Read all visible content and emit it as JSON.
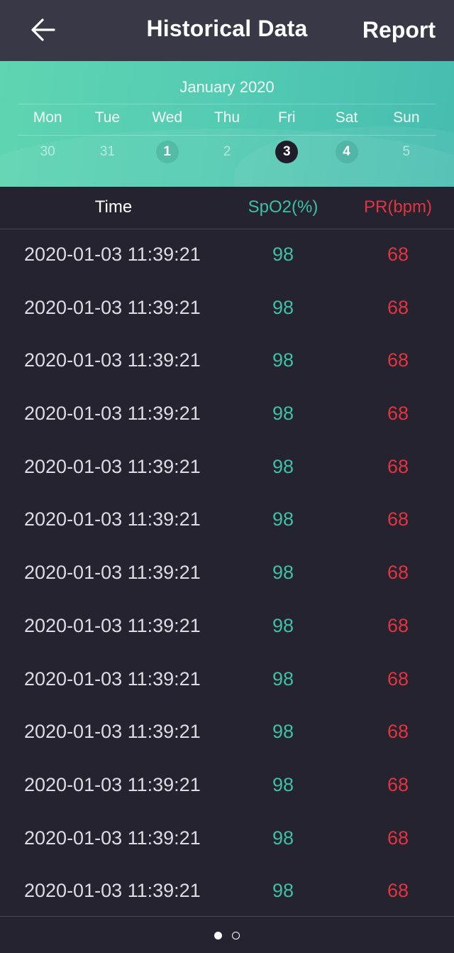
{
  "header": {
    "back_icon": "arrow-left-icon",
    "title": "Historical Data",
    "report_label": "Report"
  },
  "calendar": {
    "month_label": "January 2020",
    "weekdays": [
      "Mon",
      "Tue",
      "Wed",
      "Thu",
      "Fri",
      "Sat",
      "Sun"
    ],
    "days": [
      {
        "label": "30",
        "state": "other-month"
      },
      {
        "label": "31",
        "state": "other-month"
      },
      {
        "label": "1",
        "state": "has-data"
      },
      {
        "label": "2",
        "state": "no-data"
      },
      {
        "label": "3",
        "state": "selected"
      },
      {
        "label": "4",
        "state": "has-data"
      },
      {
        "label": "5",
        "state": "no-data"
      }
    ]
  },
  "table": {
    "columns": [
      "Time",
      "SpO2(%)",
      "PR(bpm)"
    ],
    "rows": [
      {
        "time": "2020-01-03 11:39:21",
        "spo2": "98",
        "pr": "68"
      },
      {
        "time": "2020-01-03 11:39:21",
        "spo2": "98",
        "pr": "68"
      },
      {
        "time": "2020-01-03 11:39:21",
        "spo2": "98",
        "pr": "68"
      },
      {
        "time": "2020-01-03 11:39:21",
        "spo2": "98",
        "pr": "68"
      },
      {
        "time": "2020-01-03 11:39:21",
        "spo2": "98",
        "pr": "68"
      },
      {
        "time": "2020-01-03 11:39:21",
        "spo2": "98",
        "pr": "68"
      },
      {
        "time": "2020-01-03 11:39:21",
        "spo2": "98",
        "pr": "68"
      },
      {
        "time": "2020-01-03 11:39:21",
        "spo2": "98",
        "pr": "68"
      },
      {
        "time": "2020-01-03 11:39:21",
        "spo2": "98",
        "pr": "68"
      },
      {
        "time": "2020-01-03 11:39:21",
        "spo2": "98",
        "pr": "68"
      },
      {
        "time": "2020-01-03 11:39:21",
        "spo2": "98",
        "pr": "68"
      },
      {
        "time": "2020-01-03 11:39:21",
        "spo2": "98",
        "pr": "68"
      },
      {
        "time": "2020-01-03 11:39:21",
        "spo2": "98",
        "pr": "68"
      }
    ]
  },
  "pager": {
    "total_pages": 2,
    "current_page": 1
  },
  "colors": {
    "spo2": "#3fbfa8",
    "pr": "#e0353f",
    "header_bg": "#383846",
    "body_bg": "#25232f",
    "calendar_accent": "#55ccb3"
  }
}
